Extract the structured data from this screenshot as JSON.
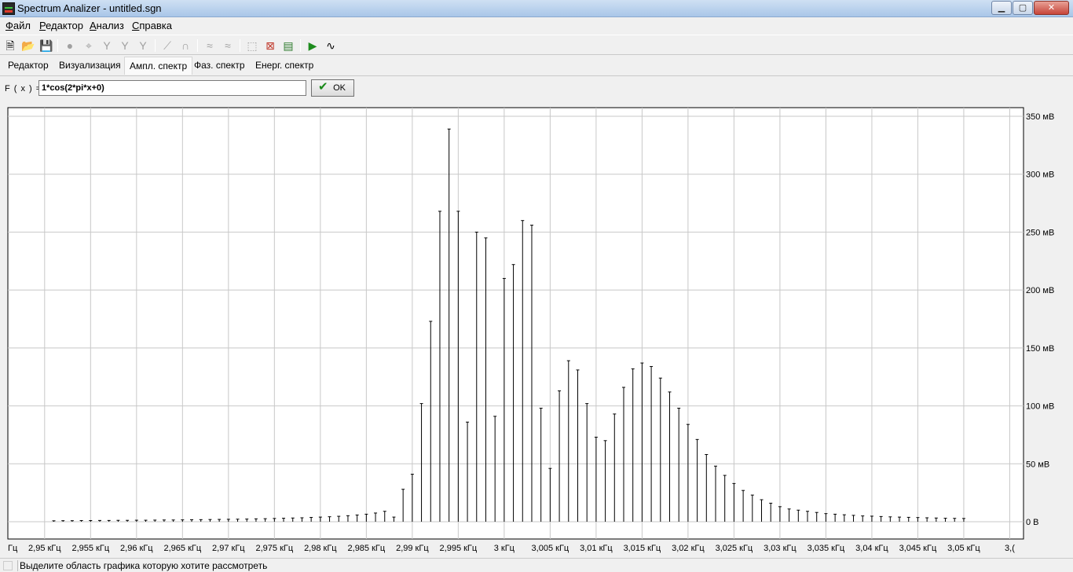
{
  "window": {
    "title": "Spectrum Analizer - untitled.sgn",
    "min_label": "▁",
    "max_label": "▢",
    "close_label": "✕"
  },
  "menu": [
    "Файл",
    "Редактор",
    "Анализ",
    "Справка"
  ],
  "toolbar": {
    "icons": [
      "new-file-icon",
      "open-folder-icon",
      "save-icon",
      "zoom-icon",
      "crosshair-icon",
      "filter-icon",
      "filter-icon",
      "filter-icon",
      "line-icon",
      "curve-icon",
      "signal-icon",
      "signal-icon",
      "zoom-area-icon",
      "zoom-reset-icon",
      "chart-icon",
      "play-icon",
      "waveform-icon"
    ]
  },
  "tabs": [
    "Редактор",
    "Визуализация",
    "Ампл. спектр",
    "Фаз. спектр",
    "Енерг. спектр"
  ],
  "active_tab": "Ампл. спектр",
  "formula": {
    "label": "F ( x ) =",
    "value": "1*cos(2*pi*x+0)",
    "ok_label": "OK"
  },
  "status": {
    "text": "Выделите область графика которую хотите рассмотреть"
  },
  "colors": {
    "grid": "#c8c8c8",
    "stem": "#000000",
    "plot_bg": "#ffffff"
  },
  "chart_data": {
    "type": "bar",
    "style": "stem",
    "grid": true,
    "x_unit": "кГц",
    "x_tick_labels": [
      "Гц",
      "2,95 кГц",
      "2,955 кГц",
      "2,96 кГц",
      "2,965 кГц",
      "2,97 кГц",
      "2,975 кГц",
      "2,98 кГц",
      "2,985 кГц",
      "2,99 кГц",
      "2,995 кГц",
      "3 кГц",
      "3,005 кГц",
      "3,01 кГц",
      "3,015 кГц",
      "3,02 кГц",
      "3,025 кГц",
      "3,03 кГц",
      "3,035 кГц",
      "3,04 кГц",
      "3,045 кГц",
      "3,05 кГц",
      "3,("
    ],
    "y_tick_labels": [
      "0 В",
      "50 мВ",
      "100 мВ",
      "150 мВ",
      "200 мВ",
      "250 мВ",
      "300 мВ",
      "350 мВ"
    ],
    "ylim": [
      0,
      0.357
    ],
    "xlim": [
      2.946,
      3.0565
    ],
    "y_unit": "В",
    "x": [
      2.951,
      2.952,
      2.953,
      2.954,
      2.955,
      2.956,
      2.957,
      2.958,
      2.959,
      2.96,
      2.961,
      2.962,
      2.963,
      2.964,
      2.965,
      2.966,
      2.967,
      2.968,
      2.969,
      2.97,
      2.971,
      2.972,
      2.973,
      2.974,
      2.975,
      2.976,
      2.977,
      2.978,
      2.979,
      2.98,
      2.981,
      2.982,
      2.983,
      2.984,
      2.985,
      2.986,
      2.987,
      2.988,
      2.989,
      2.99,
      2.991,
      2.992,
      2.993,
      2.994,
      2.995,
      2.996,
      2.997,
      2.998,
      2.999,
      3.0,
      3.001,
      3.002,
      3.003,
      3.004,
      3.005,
      3.006,
      3.007,
      3.008,
      3.009,
      3.01,
      3.011,
      3.012,
      3.013,
      3.014,
      3.015,
      3.016,
      3.017,
      3.018,
      3.019,
      3.02,
      3.021,
      3.022,
      3.023,
      3.024,
      3.025,
      3.026,
      3.027,
      3.028,
      3.029,
      3.03,
      3.031,
      3.032,
      3.033,
      3.034,
      3.035,
      3.036,
      3.037,
      3.038,
      3.039,
      3.04,
      3.041,
      3.042,
      3.043,
      3.044,
      3.045,
      3.046,
      3.047,
      3.048,
      3.049,
      3.05
    ],
    "values": [
      0.0008,
      0.0009,
      0.0009,
      0.001,
      0.001,
      0.0011,
      0.0011,
      0.0012,
      0.0012,
      0.0013,
      0.0013,
      0.0014,
      0.0015,
      0.0015,
      0.0016,
      0.0017,
      0.0018,
      0.0019,
      0.002,
      0.0021,
      0.0022,
      0.0023,
      0.0025,
      0.0026,
      0.0028,
      0.003,
      0.0032,
      0.0034,
      0.0037,
      0.004,
      0.0043,
      0.0047,
      0.0052,
      0.0058,
      0.0065,
      0.0075,
      0.009,
      0.004,
      0.028,
      0.041,
      0.102,
      0.173,
      0.268,
      0.339,
      0.268,
      0.086,
      0.25,
      0.245,
      0.091,
      0.21,
      0.222,
      0.26,
      0.256,
      0.098,
      0.046,
      0.113,
      0.139,
      0.131,
      0.102,
      0.073,
      0.07,
      0.093,
      0.116,
      0.132,
      0.137,
      0.134,
      0.124,
      0.112,
      0.098,
      0.084,
      0.071,
      0.058,
      0.048,
      0.04,
      0.033,
      0.027,
      0.023,
      0.019,
      0.016,
      0.013,
      0.011,
      0.01,
      0.009,
      0.008,
      0.007,
      0.0065,
      0.006,
      0.0055,
      0.005,
      0.0048,
      0.0045,
      0.0042,
      0.004,
      0.0038,
      0.0036,
      0.0034,
      0.0032,
      0.003,
      0.0029,
      0.0028
    ]
  }
}
